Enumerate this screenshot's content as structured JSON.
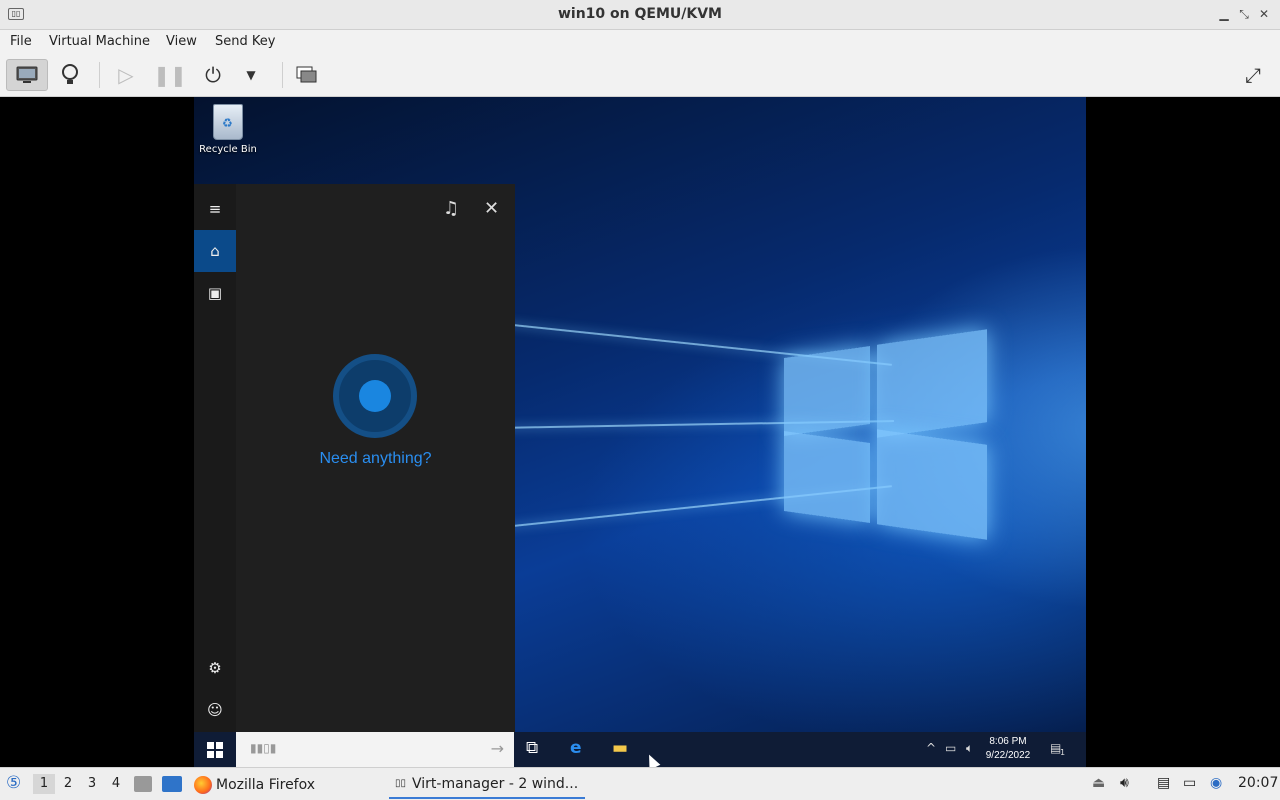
{
  "window": {
    "title": "win10 on QEMU/KVM",
    "app_icon": "virt-manager-icon",
    "controls": [
      "minimize",
      "restore",
      "close"
    ]
  },
  "menu": [
    "File",
    "Virtual Machine",
    "View",
    "Send Key"
  ],
  "toolbar": {
    "items": [
      "console-view",
      "details-view",
      "run",
      "pause",
      "shutdown",
      "shutdown-menu",
      "snapshots",
      "fullscreen"
    ],
    "active": "console-view"
  },
  "desktop": {
    "recycle_bin_label": "Recycle Bin"
  },
  "cortana": {
    "prompt": "Need anything?"
  },
  "win_taskbar": {
    "time": "8:06 PM",
    "date": "9/22/2022",
    "notification_count": "1"
  },
  "host_taskbar": {
    "workspaces": [
      "1",
      "2",
      "3",
      "4"
    ],
    "current_workspace": "1",
    "tasks": [
      {
        "label": "Mozilla Firefox",
        "active": false
      },
      {
        "label": "Virt-manager - 2 wind...",
        "active": true
      }
    ],
    "clock": "20:07"
  }
}
